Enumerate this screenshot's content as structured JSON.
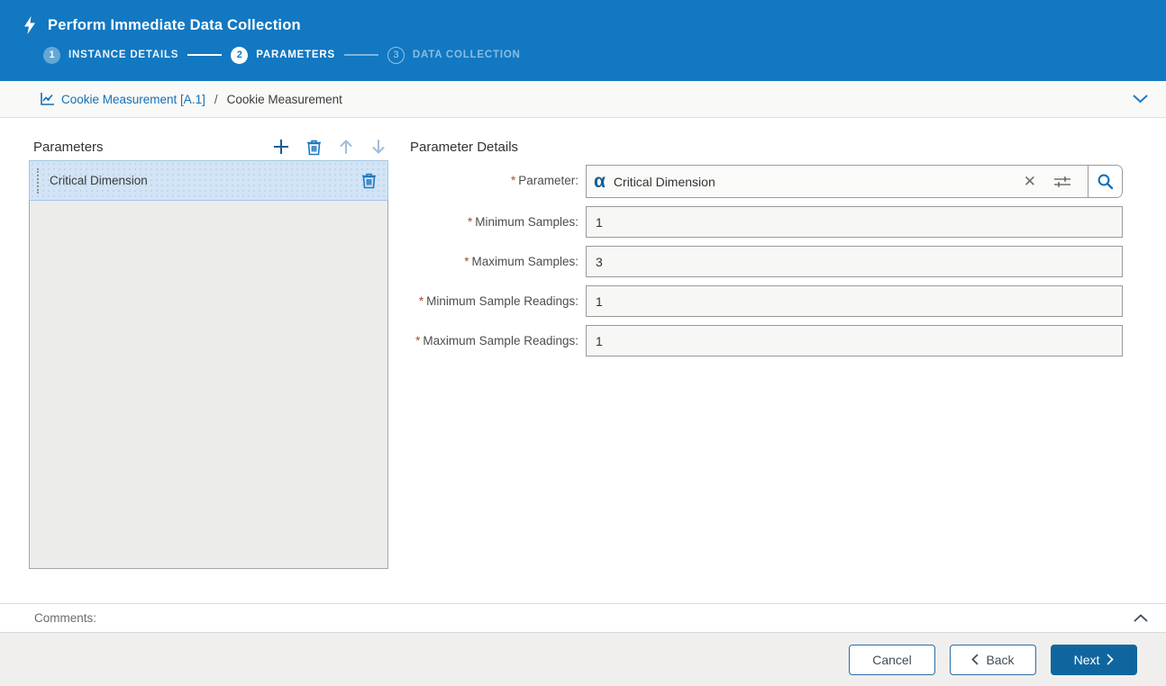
{
  "header": {
    "title": "Perform Immediate Data Collection",
    "steps": [
      {
        "num": "1",
        "label": "INSTANCE DETAILS",
        "state": "done"
      },
      {
        "num": "2",
        "label": "PARAMETERS",
        "state": "current"
      },
      {
        "num": "3",
        "label": "DATA COLLECTION",
        "state": "upcoming"
      }
    ]
  },
  "context": {
    "link": "Cookie Measurement [A.1]",
    "separator": "/",
    "current": "Cookie Measurement"
  },
  "panel": {
    "title": "Parameters",
    "items": [
      {
        "label": "Critical Dimension"
      }
    ]
  },
  "details": {
    "title": "Parameter Details",
    "required_marker": "*",
    "fields": [
      {
        "label": "Parameter:",
        "value": "Critical Dimension"
      },
      {
        "label": "Minimum Samples:",
        "value": "1"
      },
      {
        "label": "Maximum Samples:",
        "value": "3"
      },
      {
        "label": "Minimum Sample Readings:",
        "value": "1"
      },
      {
        "label": "Maximum Sample Readings:",
        "value": "1"
      }
    ]
  },
  "comments": {
    "label": "Comments:"
  },
  "footer": {
    "cancel_label": "Cancel",
    "back_label": "Back",
    "next_label": "Next"
  },
  "colors": {
    "header_blue": "#1278c1",
    "link_blue": "#166fb5",
    "icon_blue": "#1e7ac2",
    "next_button": "#0f669f",
    "selected_row": "#d2e4f5",
    "required_red": "#a94a30"
  }
}
